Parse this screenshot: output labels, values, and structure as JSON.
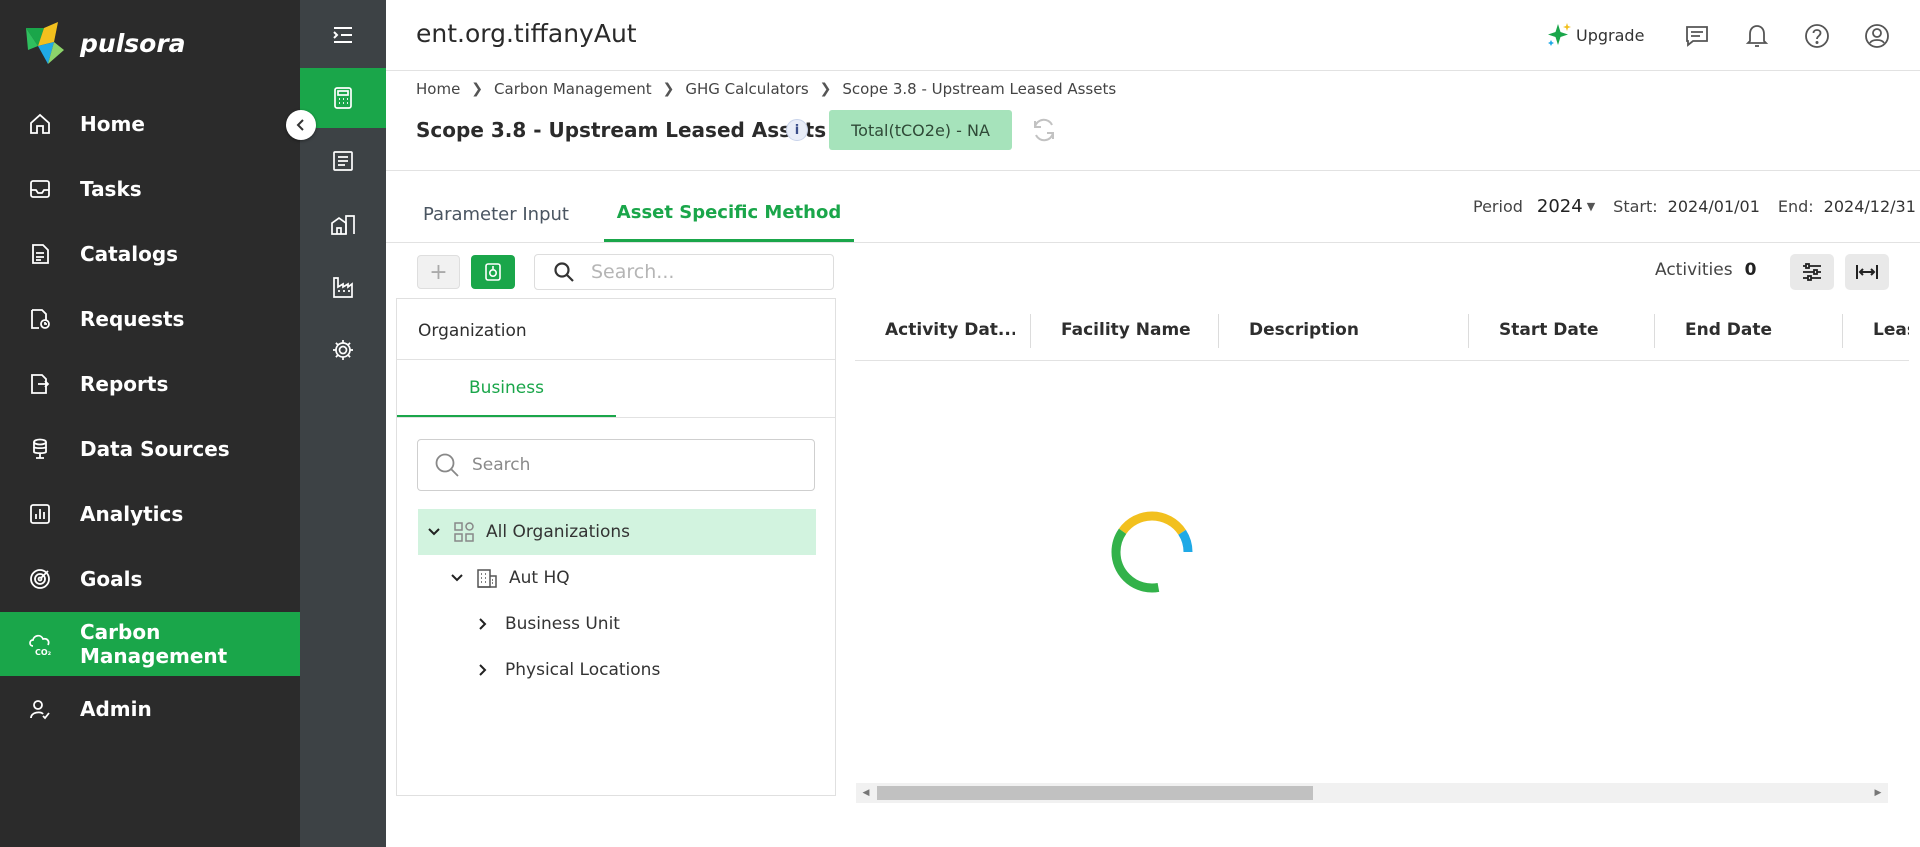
{
  "brand": {
    "name": "pulsora"
  },
  "sidebar": {
    "items": [
      {
        "label": "Home",
        "icon": "home-icon"
      },
      {
        "label": "Tasks",
        "icon": "inbox-icon"
      },
      {
        "label": "Catalogs",
        "icon": "catalog-icon"
      },
      {
        "label": "Requests",
        "icon": "requests-icon"
      },
      {
        "label": "Reports",
        "icon": "reports-icon"
      },
      {
        "label": "Data Sources",
        "icon": "database-icon"
      },
      {
        "label": "Analytics",
        "icon": "analytics-icon"
      },
      {
        "label": "Goals",
        "icon": "goals-icon"
      },
      {
        "label": "Carbon Management",
        "icon": "co2-cloud-icon",
        "active": true
      },
      {
        "label": "Admin",
        "icon": "admin-user-icon"
      }
    ]
  },
  "rail": {
    "items": [
      {
        "icon": "menu-collapse-icon"
      },
      {
        "icon": "calculator-icon",
        "active": true
      },
      {
        "icon": "ledger-icon"
      },
      {
        "icon": "building-icon"
      },
      {
        "icon": "factory-icon"
      },
      {
        "icon": "settings-icon"
      }
    ]
  },
  "topbar": {
    "title": "ent.org.tiffanyAut",
    "upgrade_label": "Upgrade"
  },
  "breadcrumb": [
    "Home",
    "Carbon Management",
    "GHG Calculators",
    "Scope 3.8 - Upstream Leased Assets"
  ],
  "header": {
    "title": "Scope 3.8 - Upstream Leased Assets",
    "info_glyph": "i",
    "total_badge": "Total(tCO2e) - NA"
  },
  "tabs": [
    {
      "label": "Parameter Input",
      "active": false
    },
    {
      "label": "Asset Specific Method",
      "active": true
    }
  ],
  "period": {
    "label": "Period",
    "year": "2024",
    "start_label": "Start:",
    "start_value": "2024/01/01",
    "end_label": "End:",
    "end_value": "2024/12/31"
  },
  "toolbar": {
    "add_glyph": "+",
    "search_placeholder": "Search...",
    "activities_label": "Activities",
    "activities_count": "0"
  },
  "org_panel": {
    "title": "Organization",
    "tab": "Business",
    "search_placeholder": "Search",
    "tree": [
      {
        "label": "All Organizations",
        "selected": true
      },
      {
        "label": "Aut HQ"
      },
      {
        "label": "Business Unit"
      },
      {
        "label": "Physical Locations"
      }
    ]
  },
  "grid": {
    "columns": [
      "Activity Dat...",
      "Facility Name",
      "Description",
      "Start Date",
      "End Date",
      "Leas"
    ],
    "rows": []
  },
  "colors": {
    "brand_green": "#1aa64a",
    "sidebar_bg": "#2b2b2b",
    "rail_bg": "#3d4245",
    "badge_bg": "#a6e3bb",
    "spinner_blue": "#1fa9e6",
    "spinner_green": "#33b24a",
    "spinner_yellow": "#f2c01e"
  }
}
